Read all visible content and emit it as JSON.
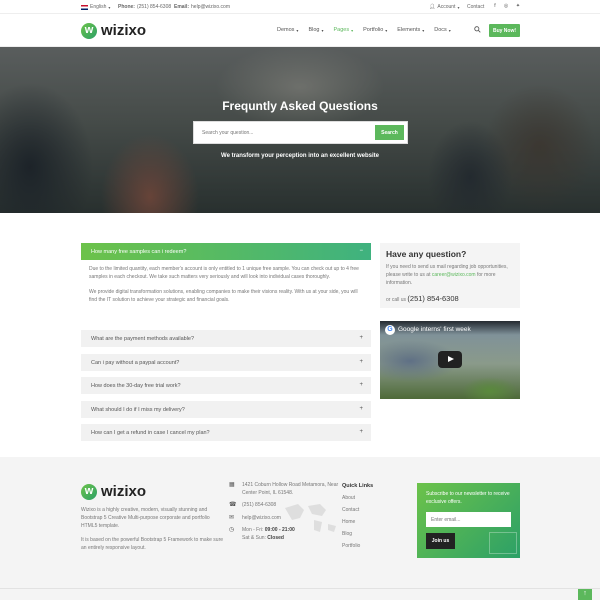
{
  "topbar": {
    "language": "English",
    "phone_label": "Phone:",
    "phone": "(251) 854-6308",
    "email_label": "Email:",
    "email": "help@wizixo.com",
    "account": "Account",
    "contact": "Contact"
  },
  "header": {
    "logo": "wizixo",
    "nav": [
      "Demos",
      "Blog",
      "Pages",
      "Portfolio",
      "Elements",
      "Docs"
    ],
    "active_nav": "Pages",
    "buy_button": "Buy Now!"
  },
  "hero": {
    "title": "Frequntly Asked Questions",
    "search_placeholder": "Search your question...",
    "search_button": "Search",
    "subtitle": "We transform your perception into an excellent website"
  },
  "faq": {
    "open_question": "How many free samples can i redeem?",
    "open_answer_1": "Due to the limited quantity, each member's account is only entitled to 1 unique free sample. You can check out up to 4 free samples in each checkout. We take such matters very seriously and will look into individual cases thoroughly.",
    "open_answer_2": "We provide digital transformation solutions, enabling companies to make their visions reality. With us at your side, you will find the IT solution to achieve your strategic and financial goals.",
    "items": [
      "What are the payment methods available?",
      "Can i pay without a paypal account?",
      "How does the 30-day free trial work?",
      "What should I do if I miss my delivery?",
      "How can I get a refund in case I cancel my plan?"
    ]
  },
  "sidebar": {
    "title": "Have any question?",
    "text": "If you need to send us mail regarding job opportunities, please write to us at",
    "email": "career@wizixo.com",
    "text_after": "for more information.",
    "call_label": "or call us",
    "call_number": "(251) 854-6308",
    "video_title": "Google interns' first week"
  },
  "footer": {
    "logo": "wizixo",
    "desc_1": "Wizixo is a highly creative, modern, visually stunning and Bootstrap 5 Creative Multi-purpose corporate and portfolio HTML5 template.",
    "desc_2": "It is based on the powerful Bootstrap 5 Framework to make sure an entirely responsive layout.",
    "address": "1421 Coburn Hollow Road Metamora, Near Center Point, IL 61548.",
    "phone": "(251) 854-6308",
    "email": "help@wizixo.com",
    "hours_1": "Mon - Fri:",
    "hours_1_time": "09:00 - 21:00",
    "hours_2": "Sat & Sun:",
    "hours_2_time": "Closed",
    "quick_links_title": "Quick Links",
    "quick_links": [
      "About",
      "Contact",
      "Home",
      "Blog",
      "Portfolio"
    ],
    "newsletter_text": "Subscribe to our newsletter to receive exclusive offers.",
    "newsletter_placeholder": "Enter email...",
    "newsletter_button": "Join us"
  },
  "colors": {
    "accent": "#5cb85c",
    "gradient_start": "#6cc24a",
    "gradient_end": "#2ca067"
  }
}
